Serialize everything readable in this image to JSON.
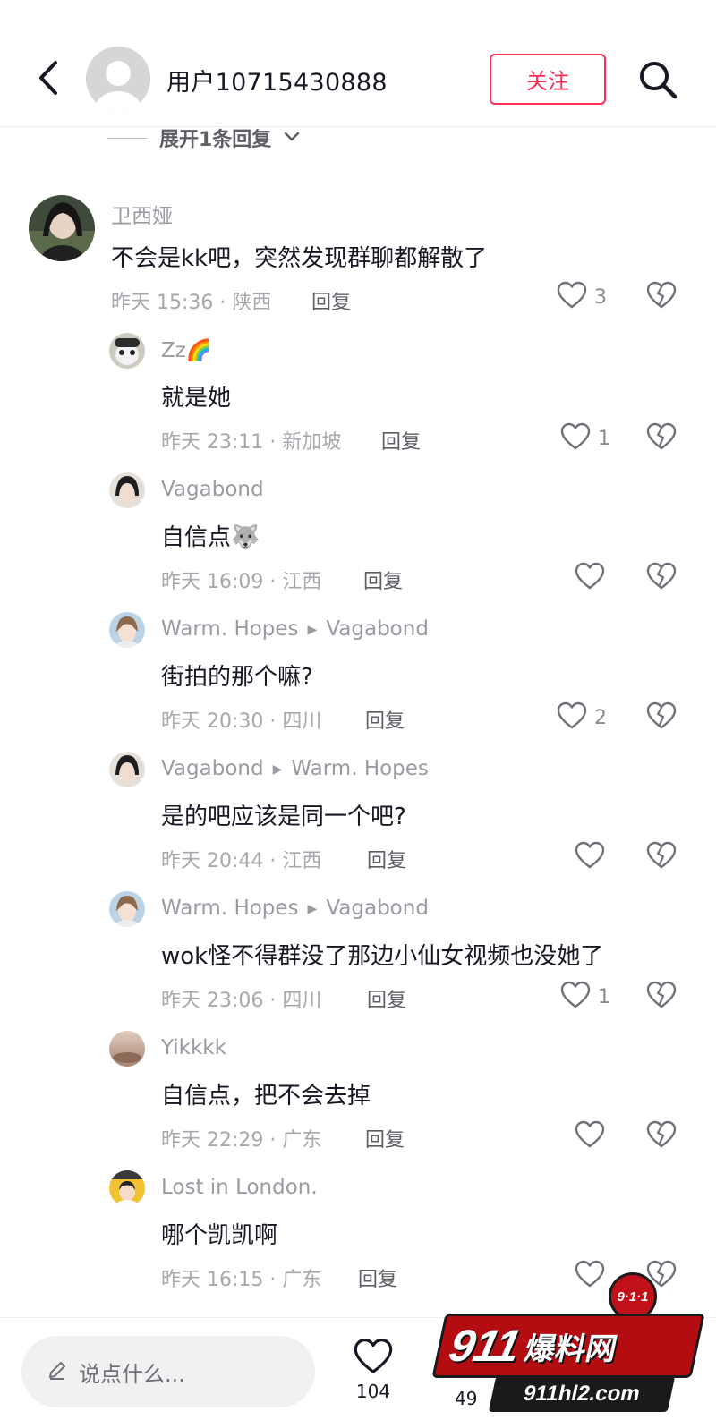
{
  "header": {
    "username": "用户10715430888",
    "follow_label": "关注"
  },
  "expand_replies": "展开1条回复",
  "comments": [
    {
      "name": "卫西娅",
      "reply_to": "",
      "text": "不会是kk吧，突然发现群聊都解散了",
      "meta": "昨天 15:36 · 陕西",
      "reply_label": "回复",
      "likes": "3"
    },
    {
      "name": "Zz🌈",
      "reply_to": "",
      "text": "就是她",
      "meta": "昨天 23:11 · 新加坡",
      "reply_label": "回复",
      "likes": "1"
    },
    {
      "name": "Vagabond",
      "reply_to": "",
      "text": "自信点🐺",
      "meta": "昨天 16:09 · 江西",
      "reply_label": "回复",
      "likes": ""
    },
    {
      "name": "Warm. Hopes",
      "reply_to": "Vagabond",
      "text": "街拍的那个嘛?",
      "meta": "昨天 20:30 · 四川",
      "reply_label": "回复",
      "likes": "2"
    },
    {
      "name": "Vagabond",
      "reply_to": "Warm. Hopes",
      "text": "是的吧应该是同一个吧?",
      "meta": "昨天 20:44 · 江西",
      "reply_label": "回复",
      "likes": ""
    },
    {
      "name": "Warm. Hopes",
      "reply_to": "Vagabond",
      "text": "wok怪不得群没了那边小仙女视频也没她了",
      "meta": "昨天 23:06 · 四川",
      "reply_label": "回复",
      "likes": "1"
    },
    {
      "name": "Yikkkk",
      "reply_to": "",
      "text": "自信点，把不会去掉",
      "meta": "昨天 22:29 · 广东",
      "reply_label": "回复",
      "likes": ""
    },
    {
      "name": "Lost in London.",
      "reply_to": "",
      "text": "哪个凯凯啊",
      "meta": "昨天 16:15 · 广东",
      "reply_label": "回复",
      "likes": ""
    }
  ],
  "bottom_bar": {
    "input_placeholder": "说点什么...",
    "like_count": "104",
    "partial_count": "49"
  },
  "watermark": {
    "badge": "9·1·1",
    "brand_number": "911",
    "brand_name": "爆料网",
    "url": "911hl2.com"
  },
  "colors": {
    "accent": "#fe2c55",
    "text": "#161823",
    "secondary": "#a7a8ad"
  }
}
